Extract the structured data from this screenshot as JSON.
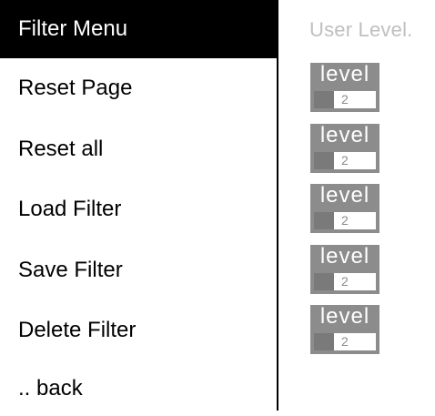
{
  "menu": {
    "title": "Filter Menu",
    "items": [
      {
        "label": "Reset Page",
        "level": {
          "word": "level",
          "value": "2"
        }
      },
      {
        "label": "Reset all",
        "level": {
          "word": "level",
          "value": "2"
        }
      },
      {
        "label": "Load Filter",
        "level": {
          "word": "level",
          "value": "2"
        }
      },
      {
        "label": "Save Filter",
        "level": {
          "word": "level",
          "value": "2"
        }
      },
      {
        "label": "Delete Filter",
        "level": {
          "word": "level",
          "value": "2"
        }
      }
    ],
    "back_label": ".. back"
  },
  "user_level": {
    "header": "User Level."
  },
  "colors": {
    "header_bg": "#000000",
    "header_text": "#ffffff",
    "badge_gray": "#8c8c8c",
    "muted_text": "#bfbfbf"
  }
}
